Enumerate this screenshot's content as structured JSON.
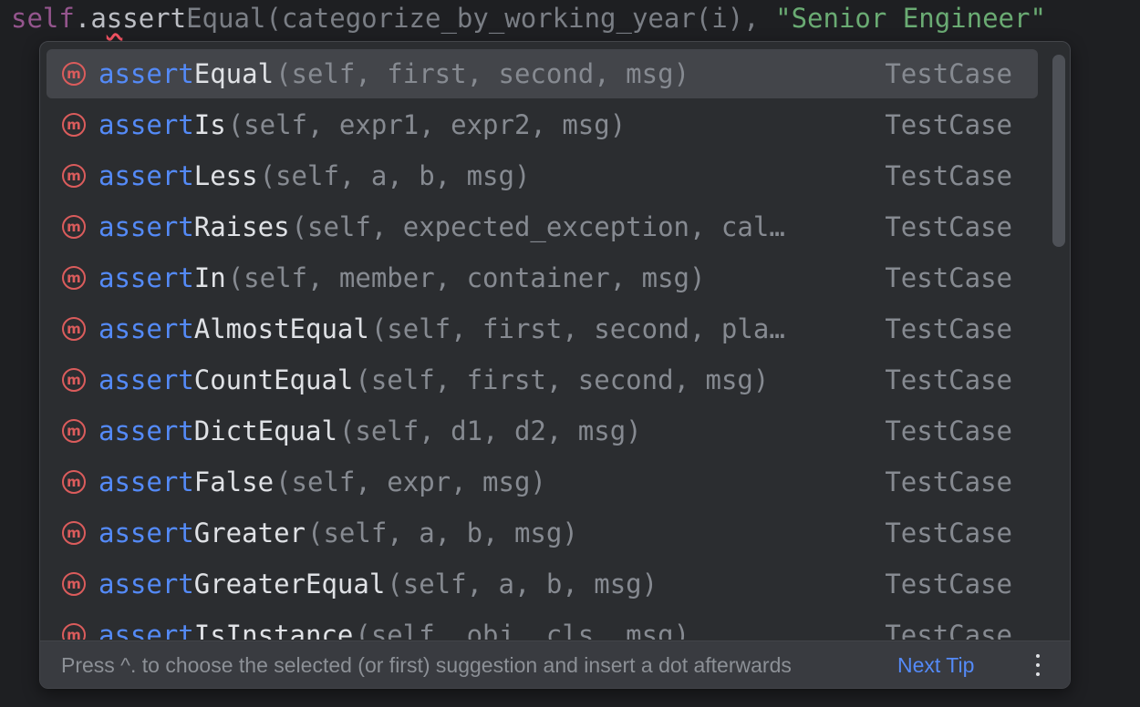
{
  "editor": {
    "self_token": "self",
    "dot": ".",
    "typed_before": "a",
    "typed_squiggle": "s",
    "typed_after": "sert",
    "ghost_completion": "Equal(categorize_by_working_year(i), ",
    "ghost_string": "\"Senior Engineer\""
  },
  "popup": {
    "items": [
      {
        "match": "assert",
        "rest": "Equal",
        "params": "(self, first, second, msg)",
        "type": "TestCase",
        "icon": "m"
      },
      {
        "match": "assert",
        "rest": "Is",
        "params": "(self, expr1, expr2, msg)",
        "type": "TestCase",
        "icon": "m"
      },
      {
        "match": "assert",
        "rest": "Less",
        "params": "(self, a, b, msg)",
        "type": "TestCase",
        "icon": "m"
      },
      {
        "match": "assert",
        "rest": "Raises",
        "params": "(self, expected_exception, cal…",
        "type": "TestCase",
        "icon": "m"
      },
      {
        "match": "assert",
        "rest": "In",
        "params": "(self, member, container, msg)",
        "type": "TestCase",
        "icon": "m"
      },
      {
        "match": "assert",
        "rest": "AlmostEqual",
        "params": "(self, first, second, pla…",
        "type": "TestCase",
        "icon": "m"
      },
      {
        "match": "assert",
        "rest": "CountEqual",
        "params": "(self, first, second, msg)",
        "type": "TestCase",
        "icon": "m"
      },
      {
        "match": "assert",
        "rest": "DictEqual",
        "params": "(self, d1, d2, msg)",
        "type": "TestCase",
        "icon": "m"
      },
      {
        "match": "assert",
        "rest": "False",
        "params": "(self, expr, msg)",
        "type": "TestCase",
        "icon": "m"
      },
      {
        "match": "assert",
        "rest": "Greater",
        "params": "(self, a, b, msg)",
        "type": "TestCase",
        "icon": "m"
      },
      {
        "match": "assert",
        "rest": "GreaterEqual",
        "params": "(self, a, b, msg)",
        "type": "TestCase",
        "icon": "m"
      },
      {
        "match": "assert",
        "rest": "IsInstance",
        "params": "(self, obj, cls, msg)",
        "type": "TestCase",
        "icon": "m"
      }
    ],
    "footer": {
      "tip": "Press ^. to choose the selected (or first) suggestion and insert a dot afterwards",
      "next_tip": "Next Tip"
    }
  },
  "colors": {
    "match_highlight": "#548af7",
    "method_icon": "#db5c5c",
    "selection": "#43454a",
    "popup_bg": "#2b2d30",
    "editor_bg": "#1e1f22"
  }
}
